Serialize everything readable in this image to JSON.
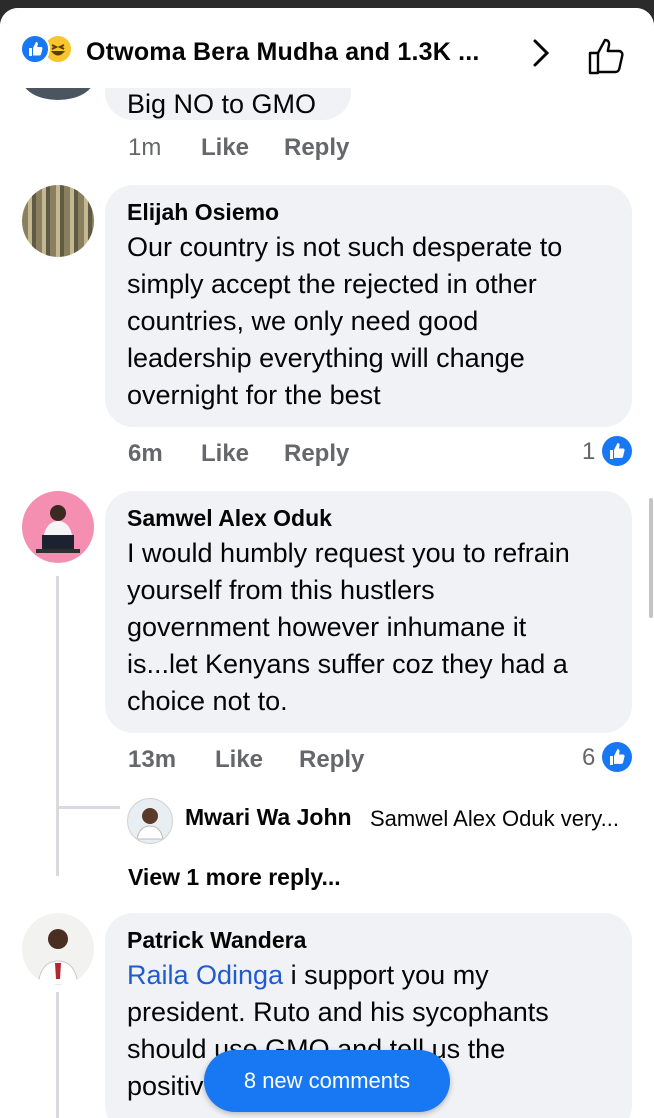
{
  "header": {
    "title": "Otwoma Bera Mudha and 1.3K ...",
    "icons": [
      "like-reaction-icon",
      "haha-reaction-icon",
      "chevron-right-icon",
      "thumbs-up-outline-icon"
    ]
  },
  "actions": {
    "like": "Like",
    "reply": "Reply"
  },
  "comments": [
    {
      "text_partial": "Big NO to GMO",
      "time": "1m"
    },
    {
      "name": "Elijah Osiemo",
      "lines": [
        "Our country is not such desperate  to",
        "simply accept the rejected in other",
        "countries, we only need good",
        "leadership everything will change",
        "overnight for the best"
      ],
      "time": "6m",
      "reactions": "1"
    },
    {
      "name": "Samwel Alex Oduk",
      "lines": [
        "I would humbly request you to refrain",
        "yourself from this hustlers",
        "government however inhumane it",
        "is...let Kenyans suffer coz they had a",
        "choice not to."
      ],
      "time": "13m",
      "reactions": "6",
      "reply": {
        "name": "Mwari Wa John",
        "text": "Samwel Alex Oduk very..."
      },
      "view_more": "View 1 more reply..."
    },
    {
      "name": "Patrick Wandera",
      "mention": "Raila Odinga",
      "line1_rest": " i support you my",
      "lines": [
        "president. Ruto and his sycophants",
        "should use GMO  and tell us the",
        "positiv"
      ]
    }
  ],
  "new_comments_button": "8 new comments",
  "colors": {
    "accent": "#1877f2",
    "bubble": "#f0f2f5",
    "muted": "#65676b"
  }
}
